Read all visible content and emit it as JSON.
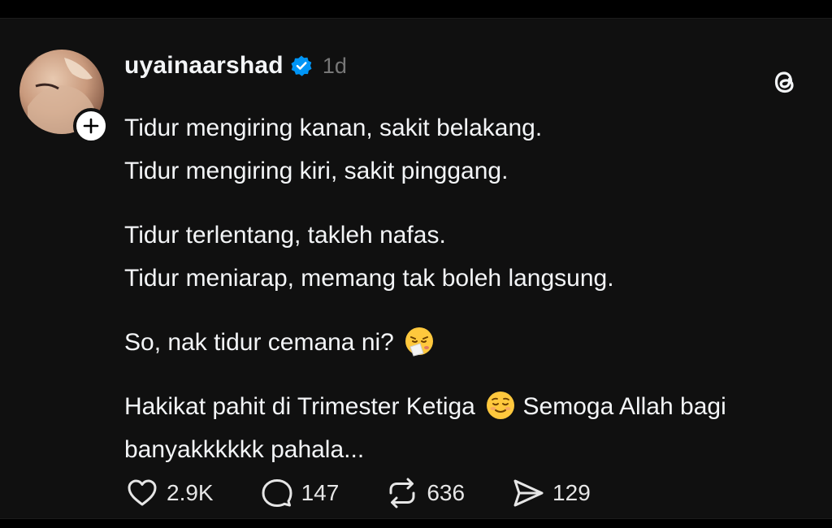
{
  "post": {
    "username": "uyainaarshad",
    "time": "1d",
    "verified": true,
    "follow_icon": "plus-icon",
    "platform_icon": "threads-logo-icon",
    "lines": {
      "p1": "Tidur mengiring kanan, sakit belakang.",
      "p2": "Tidur mengiring kiri, sakit pinggang.",
      "p3": "Tidur terlentang, takleh nafas.",
      "p4": "Tidur meniarap, memang tak boleh langsung.",
      "p5": "So, nak tidur cemana ni?",
      "p6a": "Hakikat pahit di Trimester Ketiga",
      "p6b": " Semoga Allah bagi banyakkkkkk pahala..."
    },
    "emojis": {
      "sneezing": "sneezing-face-emoji",
      "relieved": "relieved-face-emoji"
    }
  },
  "actions": {
    "likes": "2.9K",
    "replies": "147",
    "reposts": "636",
    "shares": "129"
  },
  "colors": {
    "background": "#000000",
    "card": "#101010",
    "text": "#f3f5f7",
    "muted": "#777777",
    "verified_blue": "#0095f6"
  }
}
